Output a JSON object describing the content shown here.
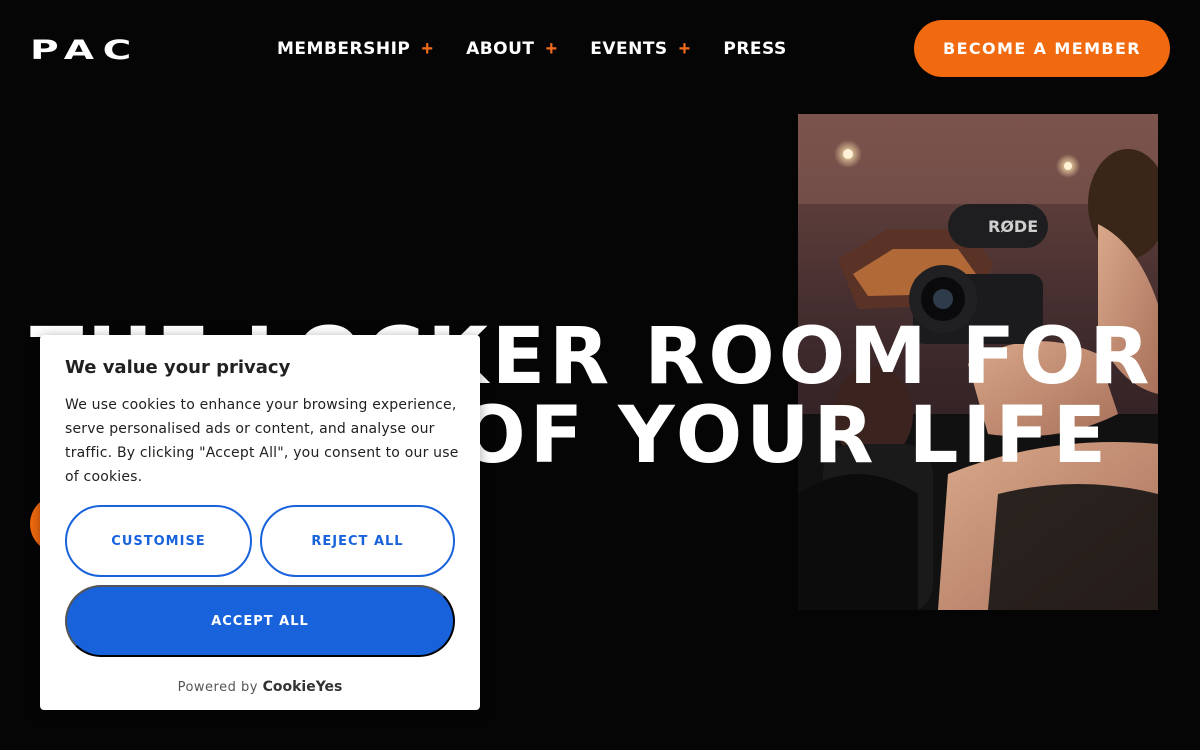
{
  "header": {
    "logo_text": "PAC",
    "nav": [
      {
        "label": "MEMBERSHIP",
        "plus": "+"
      },
      {
        "label": "ABOUT",
        "plus": "+"
      },
      {
        "label": "EVENTS",
        "plus": "+"
      },
      {
        "label": "PRESS",
        "plus": ""
      }
    ],
    "cta_label": "BECOME A MEMBER"
  },
  "hero": {
    "title_line1": "THE LOCKER ROOM FOR",
    "title_line2": "OF YOUR LIFE",
    "photo_mic_text": "RØDE"
  },
  "cookie": {
    "title": "We value your privacy",
    "text": "We use cookies to enhance your browsing experience, serve personalised ads or content, and analyse our traffic. By clicking \"Accept All\", you consent to our use of cookies.",
    "customise_label": "CUSTOMISE",
    "reject_label": "REJECT ALL",
    "accept_label": "ACCEPT ALL",
    "powered_by": "Powered by",
    "powered_brand": "CookieYes"
  },
  "colors": {
    "accent": "#f26a0f",
    "cookie_blue": "#1863dc",
    "background": "#050505"
  }
}
